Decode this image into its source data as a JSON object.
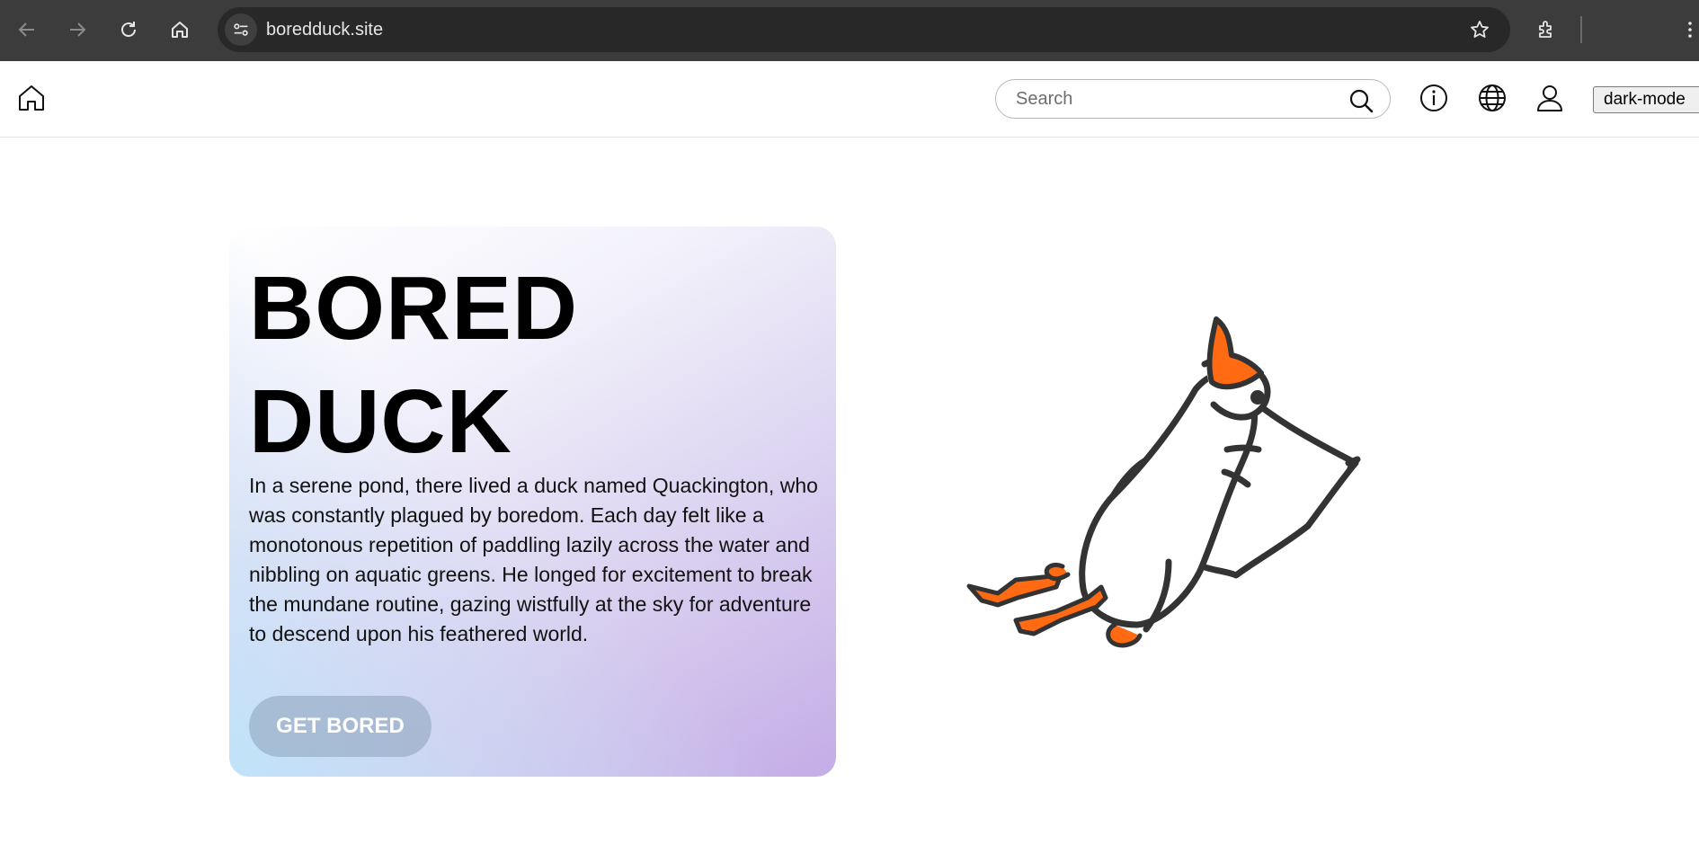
{
  "browser": {
    "url": "boredduck.site",
    "icons": [
      "back-arrow-icon",
      "forward-arrow-icon",
      "reload-icon",
      "home-icon",
      "site-settings-icon",
      "bookmark-star-icon",
      "extensions-icon",
      "menu-kebab-icon"
    ]
  },
  "header": {
    "search_placeholder": "Search",
    "dark_mode_label": "dark-mode",
    "icons": [
      "home-icon",
      "search-icon",
      "info-icon",
      "globe-icon",
      "user-icon"
    ]
  },
  "hero": {
    "title": "BORED DUCK",
    "description": "In a serene pond, there lived a duck named Quackington, who was constantly plagued by boredom. Each day felt like a monotonous repetition of paddling lazily across the water and nibbling on aquatic greens. He longed for excitement to break the mundane routine, gazing wistfully at the sky for adventure to descend upon his feathered world.",
    "button_label": "GET BORED"
  },
  "colors": {
    "chrome_bg": "#3c3c3c",
    "omnibox_bg": "#282828",
    "duck_orange": "#ff6a13",
    "duck_outline": "#333333",
    "card_gradient_start": "#bee4fa",
    "card_gradient_end": "#c4ace6"
  }
}
